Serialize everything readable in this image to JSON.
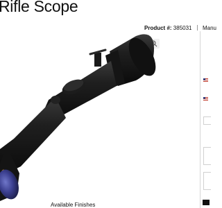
{
  "page": {
    "title": "Rifle Scope"
  },
  "product": {
    "label": "Product #:",
    "number": "385031",
    "manual_link": "Manu"
  },
  "viewer": {
    "expand_icon": "expand-icon",
    "zoom_icon": "zoom-in-icon"
  },
  "finishes": {
    "label": "Available Finishes"
  },
  "colors": {
    "scope_body": "#1a1a1a",
    "accent_ring": "#b8862d",
    "lens": "#3b3f8f"
  }
}
